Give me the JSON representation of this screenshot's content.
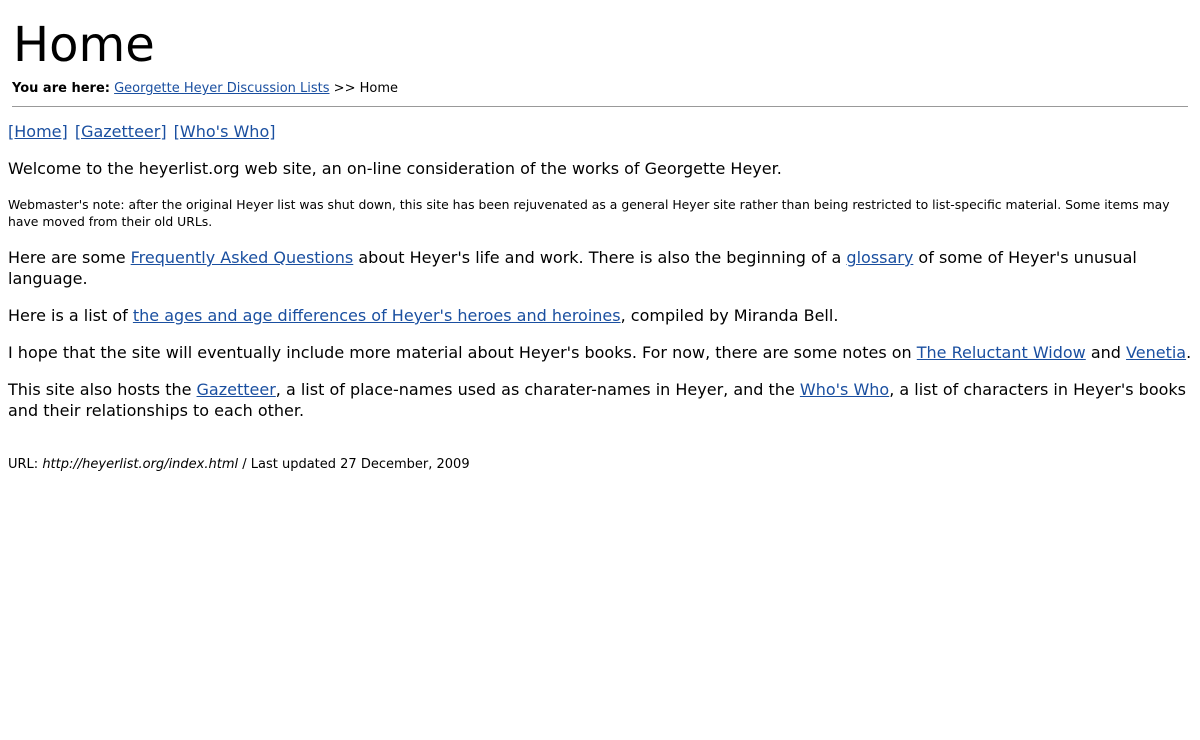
{
  "header": {
    "title": "Home"
  },
  "breadcrumb": {
    "label": "You are here:",
    "parent_link": "Georgette Heyer Discussion Lists",
    "separator": ">>",
    "current": "Home"
  },
  "nav": {
    "home": "[Home]",
    "gazetteer": "[Gazetteer]",
    "whos_who": "[Who's Who]"
  },
  "content": {
    "welcome": "Welcome to the heyerlist.org web site, an on-line consideration of the works of Georgette Heyer.",
    "webmaster_note": "Webmaster's note: after the original Heyer list was shut down, this site has been rejuvenated as a general Heyer site rather than being restricted to list-specific material. Some items may have moved from their old URLs.",
    "faq": {
      "before": "Here are some ",
      "faq_link": "Frequently Asked Questions",
      "middle": " about Heyer's life and work. There is also the beginning of a ",
      "glossary_link": "glossary",
      "after": " of some of Heyer's unusual language."
    },
    "ages": {
      "before": "Here is a list of ",
      "link": "the ages and age differences of Heyer's heroes and heroines",
      "after": ", compiled by Miranda Bell."
    },
    "hope": {
      "before": "I hope that the site will eventually include more material about Heyer's books. For now, there are some notes on ",
      "widow_link": "The Reluctant Widow",
      "and": " and ",
      "venetia_link": "Venetia",
      "after": "."
    },
    "hosts": {
      "before": "This site also hosts the ",
      "gazetteer_link": "Gazetteer",
      "middle": ", a list of place-names used as charater-names in Heyer, and the ",
      "whos_who_link": "Who's Who",
      "after": ", a list of characters in Heyer's books and their relationships to each other."
    }
  },
  "footer": {
    "url_label": "URL: ",
    "url": "http://heyerlist.org/index.html",
    "updated": " / Last updated 27 December, 2009"
  },
  "colors": {
    "link": "#1a4fa0",
    "rule": "#999999",
    "text": "#000000",
    "background": "#ffffff"
  }
}
